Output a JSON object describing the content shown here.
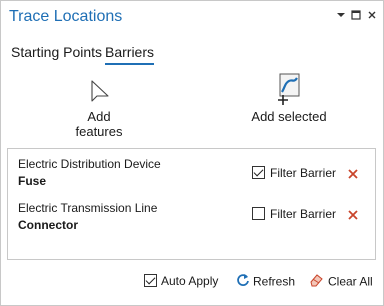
{
  "window": {
    "title": "Trace Locations",
    "menu_icon": "dropdown-caret-icon",
    "restore_icon": "restore-window-icon",
    "close_icon": "close-icon"
  },
  "tabs": [
    {
      "label": "Starting Points",
      "active": false
    },
    {
      "label": "Barriers",
      "active": true
    }
  ],
  "tools": {
    "add_features": {
      "label_line1": "Add",
      "label_line2": "features",
      "icon": "pointer-arrow-icon"
    },
    "add_selected": {
      "label": "Add selected",
      "icon": "add-selected-map-icon"
    }
  },
  "barriers": [
    {
      "layer": "Electric Distribution Device",
      "feature": "Fuse",
      "filter_label": "Filter Barrier",
      "filter_checked": true
    },
    {
      "layer": "Electric Transmission Line",
      "feature": "Connector",
      "filter_label": "Filter Barrier",
      "filter_checked": false
    }
  ],
  "footer": {
    "auto_apply_label": "Auto Apply",
    "auto_apply_checked": true,
    "refresh_label": "Refresh",
    "clear_all_label": "Clear All"
  },
  "colors": {
    "accent": "#1f6fb5",
    "remove": "#c9452b",
    "border": "#c8c8c8"
  }
}
